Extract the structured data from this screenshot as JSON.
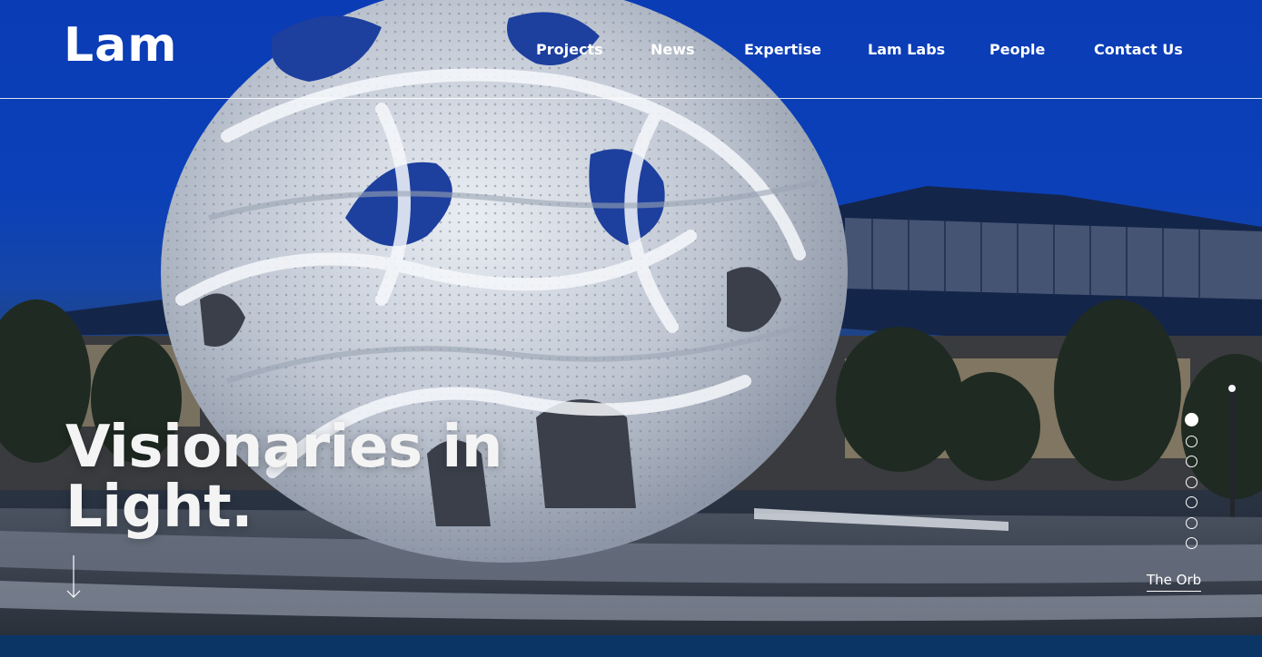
{
  "brand": {
    "logo_text": "Lam"
  },
  "nav": {
    "items": [
      {
        "label": "Projects"
      },
      {
        "label": "News"
      },
      {
        "label": "Expertise"
      },
      {
        "label": "Lam Labs"
      },
      {
        "label": "People"
      },
      {
        "label": "Contact Us"
      }
    ]
  },
  "hero": {
    "headline_line1": "Visionaries in",
    "headline_line2": "Light.",
    "image_subject": "sculpture-sphere",
    "caption": "The Orb",
    "slides": {
      "count": 7,
      "active_index": 0
    }
  },
  "colors": {
    "sky": "#0b40b8",
    "footer": "#0b3565",
    "text": "#ffffff"
  }
}
